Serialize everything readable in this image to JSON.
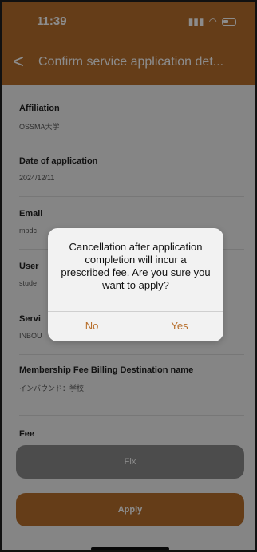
{
  "status": {
    "time": "11:39",
    "signal": "‖‖",
    "wifi": "wifi"
  },
  "nav": {
    "back": "<",
    "title": "Confirm service application det..."
  },
  "fields": [
    {
      "label": "Affiliation",
      "value": "OSSMA大学"
    },
    {
      "label": "Date of application",
      "value": "2024/12/11"
    },
    {
      "label": "Email",
      "value": "mpdc"
    },
    {
      "label": "User",
      "value": "stude"
    },
    {
      "label": "Servi",
      "value": "INBOU"
    },
    {
      "label": "Membership Fee Billing Destination name",
      "value": "インバウンド：学校"
    },
    {
      "label": "Fee",
      "value": ""
    }
  ],
  "buttons": {
    "fix": "Fix",
    "apply": "Apply"
  },
  "dialog": {
    "message": "Cancellation after application completion will incur a prescribed fee. Are you sure you want to apply?",
    "no": "No",
    "yes": "Yes"
  },
  "colors": {
    "accent": "#b86f2c"
  }
}
